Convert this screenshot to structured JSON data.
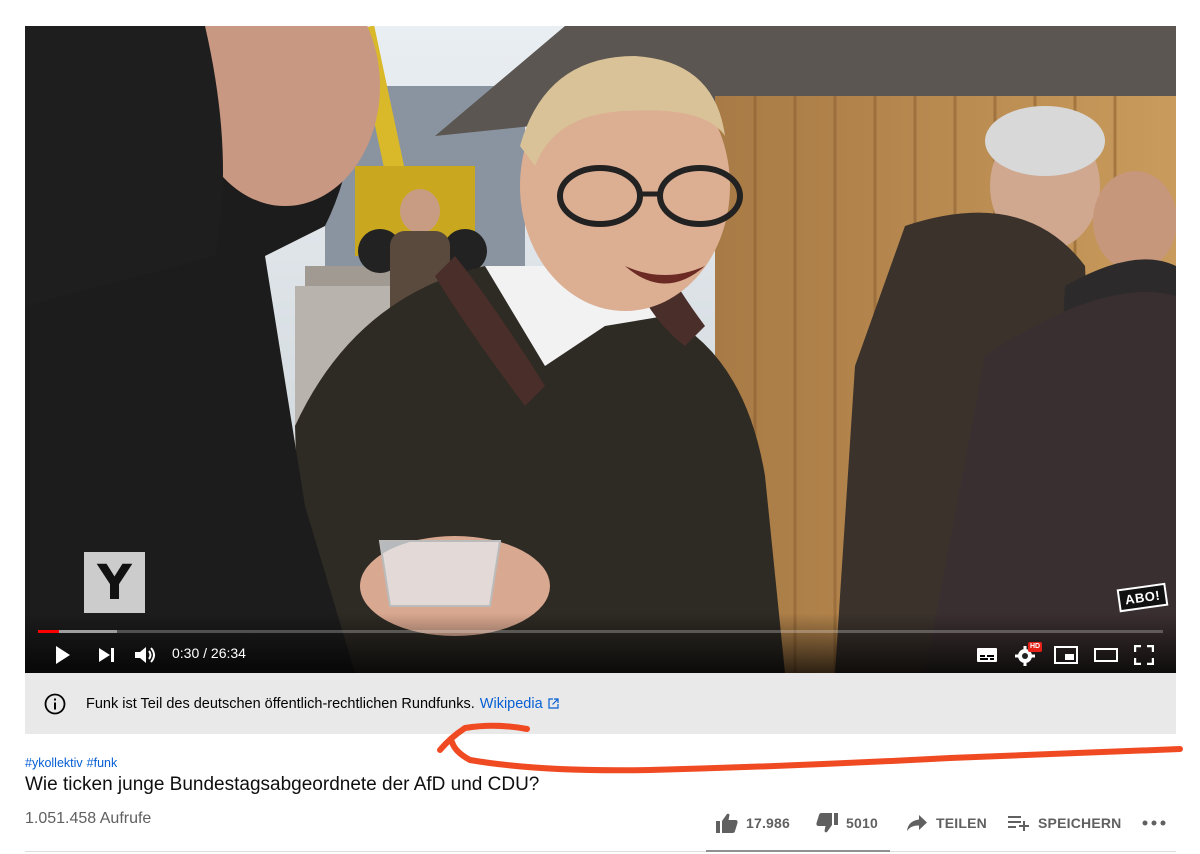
{
  "player": {
    "current_time": "0:30",
    "duration": "26:34",
    "time_display": "0:30 / 26:34",
    "progress_fraction": 0.019,
    "buffer_fraction": 0.07,
    "progress_color": "#ff0000",
    "channel_watermark": "Y",
    "subscribe_badge": "ABO!",
    "hd_badge": "HD",
    "icons": [
      "play-icon",
      "next-icon",
      "volume-icon",
      "subtitles-icon",
      "settings-icon",
      "miniplayer-icon",
      "theater-mode-icon",
      "fullscreen-icon"
    ]
  },
  "info_panel": {
    "text": "Funk ist Teil des deutschen öffentlich-rechtlichen Rundfunks.",
    "link_label": "Wikipedia"
  },
  "hashtags": [
    "#ykollektiv",
    "#funk"
  ],
  "video": {
    "title": "Wie ticken junge Bundestagsabgeordnete der AfD und CDU?",
    "views": "1.051.458 Aufrufe"
  },
  "actions": {
    "likes": "17.986",
    "dislikes": "5010",
    "share_label": "TEILEN",
    "save_label": "SPEICHERN"
  },
  "colors": {
    "link": "#065fd4",
    "annotation": "#f04a23"
  }
}
